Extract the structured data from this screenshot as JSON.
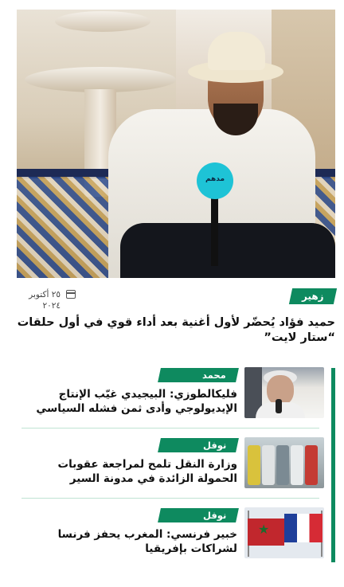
{
  "featured": {
    "category": "زهير",
    "date": "٢٥ أكتوبر ٢٠٢٤",
    "headline": "حميد فؤاد يُحضّر لأول أغنية بعد أداء قوي في أول حلقات “ستار لايت”",
    "image_logo_text": "مدهم"
  },
  "articles": [
    {
      "author": "محمد",
      "title": "فليكالطوزي: البيجيدي غيّب الإنتاج الإيديولوجي وأدى ثمن فشله السياسي"
    },
    {
      "author": "نوفل",
      "title": "وزارة النقل تلمح لمراجعة عقوبات الحمولة الزائدة في مدونة السير"
    },
    {
      "author": "نوفل",
      "title": "خبير فرنسي: المغرب يحفز فرنسا لشراكات بإفريقيا"
    }
  ],
  "colors": {
    "accent": "#0e8a5f",
    "divider": "#bfe3d3"
  },
  "icons": {
    "date": "calendar-icon"
  }
}
